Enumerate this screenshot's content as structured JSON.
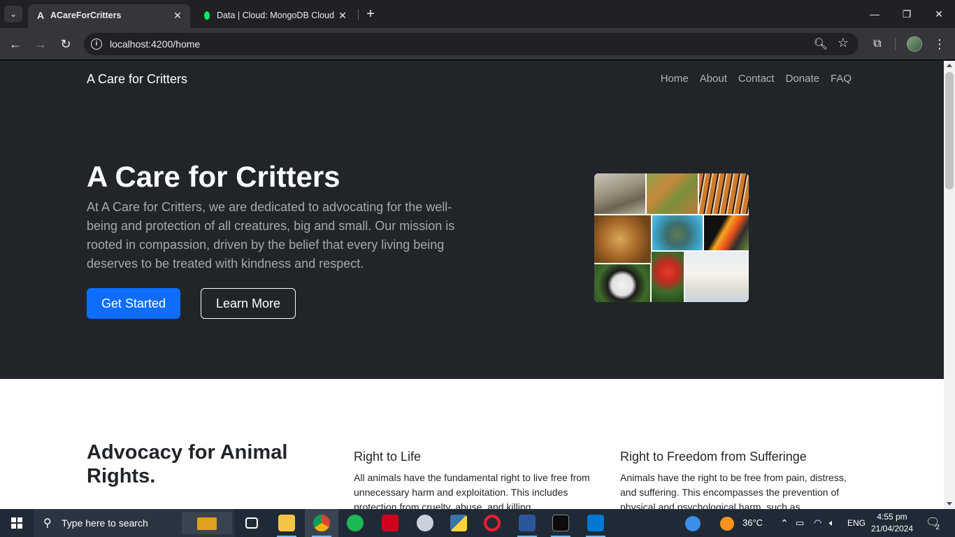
{
  "browser": {
    "tabs": [
      {
        "title": "ACareForCritters",
        "favicon": "angular-icon",
        "active": true
      },
      {
        "title": "Data | Cloud: MongoDB Cloud",
        "favicon": "mongodb-leaf-icon",
        "active": false
      }
    ],
    "url": "localhost:4200/home"
  },
  "site": {
    "brand": "A Care for Critters",
    "nav": [
      "Home",
      "About",
      "Contact",
      "Donate",
      "FAQ"
    ],
    "hero": {
      "title": "A Care for Critters",
      "text": "At A Care for Critters, we are dedicated to advocating for the well-being and protection of all creatures, big and small. Our mission is rooted in compassion, driven by the belief that every living being deserves to be treated with kindness and respect.",
      "primary_button": "Get Started",
      "secondary_button": "Learn More",
      "image_animals": [
        "wolf",
        "giraffe",
        "tiger",
        "lion",
        "sea turtle",
        "toucan",
        "panda",
        "poison dart frog",
        "polar bears"
      ]
    },
    "advocacy": {
      "title": "Advocacy for Animal Rights.",
      "features": [
        {
          "title": "Right to Life",
          "text": "All animals have the fundamental right to live free from unnecessary harm and exploitation. This includes protection from cruelty, abuse, and killing"
        },
        {
          "title": "Right to Freedom from Sufferinge",
          "text": "Animals have the right to be free from pain, distress, and suffering. This encompasses the prevention of physical and psychological harm, such as"
        }
      ]
    }
  },
  "taskbar": {
    "search_placeholder": "Type here to search",
    "weather": "36°C",
    "language": "ENG",
    "time": "4:55 pm",
    "date": "21/04/2024",
    "notifications": "2"
  },
  "colors": {
    "hero_bg": "#212529",
    "primary": "#0d6efd"
  }
}
